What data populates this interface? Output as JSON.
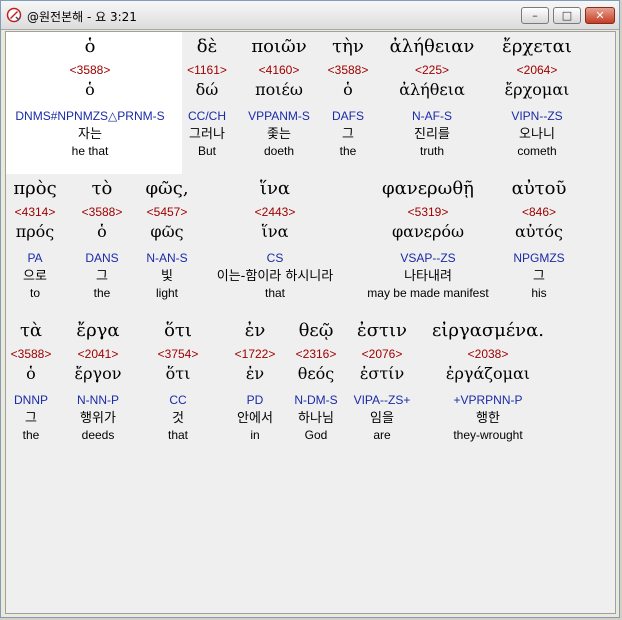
{
  "window": {
    "title": "@원전본해 - 요 3:21"
  },
  "lines": [
    {
      "words": [
        {
          "greek": "ὁ",
          "strong": "<3588>",
          "lemma": "ὁ",
          "morph": "DNMS#NPNMZS△PRNM-S",
          "korean": "자는",
          "english": "he that"
        },
        {
          "greek": "δὲ",
          "strong": "<1161>",
          "lemma": "δώ",
          "morph": "CC/CH",
          "korean": "그러나",
          "english": "But"
        },
        {
          "greek": "ποιῶν",
          "strong": "<4160>",
          "lemma": "ποιέω",
          "morph": "VPPANM-S",
          "korean": "좇는",
          "english": "doeth"
        },
        {
          "greek": "τὴν",
          "strong": "<3588>",
          "lemma": "ὁ",
          "morph": "DAFS",
          "korean": "그",
          "english": "the"
        },
        {
          "greek": "ἀλήθειαν",
          "strong": "<225>",
          "lemma": "ἀλήθεια",
          "morph": "N-AF-S",
          "korean": "진리를",
          "english": "truth"
        },
        {
          "greek": "ἔρχεται",
          "strong": "<2064>",
          "lemma": "ἔρχομαι",
          "morph": "VIPN--ZS",
          "korean": "오나니",
          "english": "cometh"
        }
      ]
    },
    {
      "words": [
        {
          "greek": "πρὸς",
          "strong": "<4314>",
          "lemma": "πρός",
          "morph": "PA",
          "korean": "으로",
          "english": "to"
        },
        {
          "greek": "τὸ",
          "strong": "<3588>",
          "lemma": "ὁ",
          "morph": "DANS",
          "korean": "그",
          "english": "the"
        },
        {
          "greek": "φῶς,",
          "strong": "<5457>",
          "lemma": "φῶς",
          "morph": "N-AN-S",
          "korean": "빛",
          "english": "light"
        },
        {
          "greek": "ἵνα",
          "strong": "<2443>",
          "lemma": "ἵνα",
          "morph": "CS",
          "korean": "이는-함이라 하시니라",
          "english": "that"
        },
        {
          "greek": "φανερωθῇ",
          "strong": "<5319>",
          "lemma": "φανερόω",
          "morph": "VSAP--ZS",
          "korean": "나타내려",
          "english": "may be made manifest"
        },
        {
          "greek": "αὐτοῦ",
          "strong": "<846>",
          "lemma": "αὐτός",
          "morph": "NPGMZS",
          "korean": "그",
          "english": "his"
        }
      ]
    },
    {
      "words": [
        {
          "greek": "τὰ",
          "strong": "<3588>",
          "lemma": "ὁ",
          "morph": "DNNP",
          "korean": "그",
          "english": "the"
        },
        {
          "greek": "ἔργα",
          "strong": "<2041>",
          "lemma": "ἔργον",
          "morph": "N-NN-P",
          "korean": "행위가",
          "english": "deeds"
        },
        {
          "greek": "ὅτι",
          "strong": "<3754>",
          "lemma": "ὅτι",
          "morph": "CC",
          "korean": "것",
          "english": "that"
        },
        {
          "greek": "ἐν",
          "strong": "<1722>",
          "lemma": "ἐν",
          "morph": "PD",
          "korean": "안에서",
          "english": "in"
        },
        {
          "greek": "θεῷ",
          "strong": "<2316>",
          "lemma": "θεός",
          "morph": "N-DM-S",
          "korean": "하나님",
          "english": "God"
        },
        {
          "greek": "ἐστιν",
          "strong": "<2076>",
          "lemma": "ἐστίν",
          "morph": "VIPA--ZS+",
          "korean": "임을",
          "english": "are"
        },
        {
          "greek": "εἰργασμένα.",
          "strong": "<2038>",
          "lemma": "ἐργάζομαι",
          "morph": "+VPRPNN-P",
          "korean": "행한",
          "english": "they-wrought"
        }
      ]
    }
  ]
}
